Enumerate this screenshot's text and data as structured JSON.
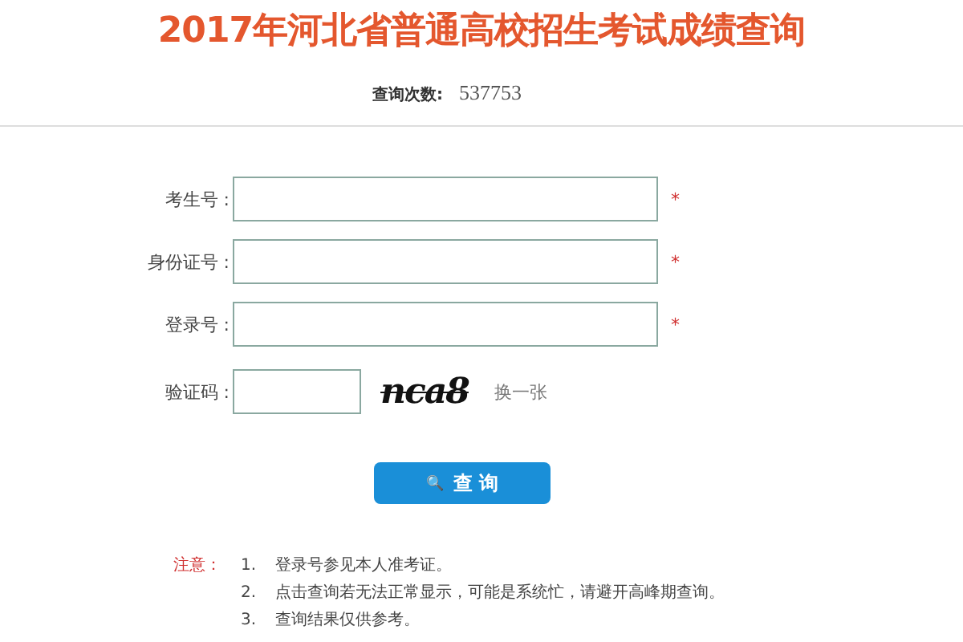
{
  "title": "2017年河北省普通高校招生考试成绩查询",
  "query_count": {
    "label": "查询次数:",
    "value": "537753"
  },
  "fields": [
    {
      "kind": "text",
      "label": "考生号 :",
      "required_mark": "*"
    },
    {
      "kind": "text",
      "label": "身份证号 :",
      "required_mark": "*"
    },
    {
      "kind": "text",
      "label": "登录号 :",
      "required_mark": "*"
    },
    {
      "kind": "captcha",
      "label": "验证码 :",
      "captcha": "nca8",
      "refresh": "换一张"
    }
  ],
  "button": {
    "icon": "🔍",
    "label": "查 询"
  },
  "notice": {
    "label": "注意：",
    "items": [
      {
        "number": "1.",
        "text": "登录号参见本人准考证。"
      },
      {
        "number": "2.",
        "text": "点击查询若无法正常显示，可能是系统忙，请避开高峰期查询。"
      },
      {
        "number": "3.",
        "text": "查询结果仅供参考。"
      }
    ]
  }
}
